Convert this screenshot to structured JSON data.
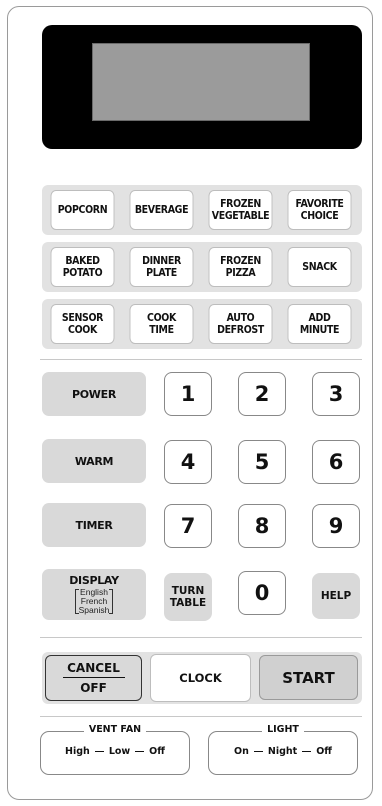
{
  "sensor_row_1": [
    "POPCORN",
    "BEVERAGE",
    "FROZEN\nVEGETABLE",
    "FAVORITE\nCHOICE"
  ],
  "sensor_row_2": [
    "BAKED\nPOTATO",
    "DINNER\nPLATE",
    "FROZEN\nPIZZA",
    "SNACK"
  ],
  "sensor_row_3": [
    "SENSOR\nCOOK",
    "COOK\nTIME",
    "AUTO\nDEFROST",
    "ADD\nMINUTE"
  ],
  "function_keys": {
    "power": "POWER",
    "warm": "WARM",
    "timer": "TIMER"
  },
  "number_keys": [
    "1",
    "2",
    "3",
    "4",
    "5",
    "6",
    "7",
    "8",
    "9",
    "0"
  ],
  "display_key": {
    "title": "DISPLAY",
    "languages": [
      "English",
      "French",
      "Spanish"
    ]
  },
  "turn_table": "TURN\nTABLE",
  "help": "HELP",
  "cancel": {
    "top": "CANCEL",
    "bottom": "OFF"
  },
  "clock": "CLOCK",
  "start": "START",
  "vent_fan": {
    "title": "VENT FAN",
    "options": [
      "High",
      "Low",
      "Off"
    ]
  },
  "light": {
    "title": "LIGHT",
    "options": [
      "On",
      "Night",
      "Off"
    ]
  }
}
